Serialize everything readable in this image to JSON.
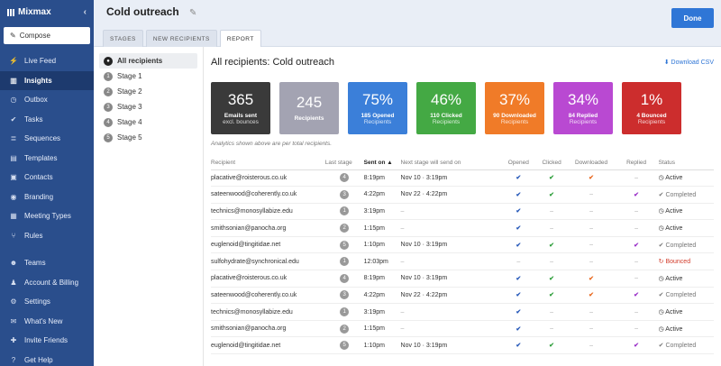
{
  "app": {
    "name": "Mixmax",
    "compose": "Compose"
  },
  "sidebar": {
    "items": [
      {
        "label": "Live Feed",
        "icon": "bolt-icon",
        "glyph": "⚡"
      },
      {
        "label": "Insights",
        "icon": "bar-chart-icon",
        "glyph": "▥",
        "active": true
      },
      {
        "label": "Outbox",
        "icon": "clock-icon",
        "glyph": "◷"
      },
      {
        "label": "Tasks",
        "icon": "check-circle-icon",
        "glyph": "✔"
      },
      {
        "label": "Sequences",
        "icon": "sequences-icon",
        "glyph": "≣"
      },
      {
        "label": "Templates",
        "icon": "document-icon",
        "glyph": "▤"
      },
      {
        "label": "Contacts",
        "icon": "contact-card-icon",
        "glyph": "▣"
      },
      {
        "label": "Branding",
        "icon": "palette-icon",
        "glyph": "◉"
      },
      {
        "label": "Meeting Types",
        "icon": "calendar-icon",
        "glyph": "▦"
      },
      {
        "label": "Rules",
        "icon": "rules-icon",
        "glyph": "⑂"
      }
    ],
    "bottom_items": [
      {
        "label": "Teams",
        "icon": "team-icon",
        "glyph": "☻"
      },
      {
        "label": "Account & Billing",
        "icon": "person-icon",
        "glyph": "♟"
      },
      {
        "label": "Settings",
        "icon": "gear-icon",
        "glyph": "⚙"
      },
      {
        "label": "What's New",
        "icon": "megaphone-icon",
        "glyph": "✉"
      },
      {
        "label": "Invite Friends",
        "icon": "gift-icon",
        "glyph": "✚"
      },
      {
        "label": "Get Help",
        "icon": "help-icon",
        "glyph": "?"
      }
    ]
  },
  "header": {
    "title": "Cold outreach",
    "done": "Done",
    "tabs": [
      "STAGES",
      "NEW RECIPIENTS",
      "REPORT"
    ],
    "active_tab": 2
  },
  "stages": [
    {
      "num": "●",
      "label": "All recipients",
      "active": true
    },
    {
      "num": "1",
      "label": "Stage 1"
    },
    {
      "num": "2",
      "label": "Stage 2"
    },
    {
      "num": "3",
      "label": "Stage 3"
    },
    {
      "num": "4",
      "label": "Stage 4"
    },
    {
      "num": "5",
      "label": "Stage 5"
    }
  ],
  "report": {
    "title": "All recipients: Cold outreach",
    "download": "Download CSV",
    "note": "Analytics shown above are per total recipients.",
    "cards": [
      {
        "big": "365",
        "l1": "Emails sent",
        "l2": "excl. bounces",
        "color": "#3a3a3a"
      },
      {
        "big": "245",
        "l1": "Recipients",
        "l2": "",
        "color": "#a3a3b2"
      },
      {
        "big": "75%",
        "l1": "185 Opened",
        "l2": "Recipients",
        "color": "#3b7fd9"
      },
      {
        "big": "46%",
        "l1": "110 Clicked",
        "l2": "Recipients",
        "color": "#44a944"
      },
      {
        "big": "37%",
        "l1": "90 Downloaded",
        "l2": "Recipients",
        "color": "#f07b28"
      },
      {
        "big": "34%",
        "l1": "84 Replied",
        "l2": "Recipients",
        "color": "#b949d2"
      },
      {
        "big": "1%",
        "l1": "4 Bounced",
        "l2": "Recipients",
        "color": "#cc2d2d"
      }
    ],
    "columns": [
      "Recipient",
      "Last stage",
      "Sent on",
      "Next stage will send on",
      "Opened",
      "Clicked",
      "Downloaded",
      "Replied",
      "Status"
    ],
    "rows": [
      {
        "email": "placative@roisterous.co.uk",
        "stage": "4",
        "sent": "8:19pm",
        "next": "Nov 10 · 3:19pm",
        "opened": "✔",
        "clicked": "✔",
        "downloaded": "✔",
        "replied": "–",
        "status": "Active",
        "status_icon": "◷"
      },
      {
        "email": "sateenwood@coherently.co.uk",
        "stage": "3",
        "sent": "4:22pm",
        "next": "Nov 22 · 4:22pm",
        "opened": "✔",
        "clicked": "✔",
        "downloaded": "–",
        "replied": "✔",
        "status": "Completed",
        "status_icon": "✔"
      },
      {
        "email": "technics@monosyllabize.edu",
        "stage": "1",
        "sent": "3:19pm",
        "next": "–",
        "opened": "✔",
        "clicked": "–",
        "downloaded": "–",
        "replied": "–",
        "status": "Active",
        "status_icon": "◷"
      },
      {
        "email": "smithsonian@panocha.org",
        "stage": "2",
        "sent": "1:15pm",
        "next": "–",
        "opened": "✔",
        "clicked": "–",
        "downloaded": "–",
        "replied": "–",
        "status": "Active",
        "status_icon": "◷"
      },
      {
        "email": "euglenoid@tingitidae.net",
        "stage": "5",
        "sent": "1:10pm",
        "next": "Nov 10 · 3:19pm",
        "opened": "✔",
        "clicked": "✔",
        "downloaded": "–",
        "replied": "✔",
        "status": "Completed",
        "status_icon": "✔"
      },
      {
        "email": "sulfohydrate@synchronical.edu",
        "stage": "1",
        "sent": "12:03pm",
        "next": "–",
        "opened": "–",
        "clicked": "–",
        "downloaded": "–",
        "replied": "–",
        "status": "Bounced",
        "status_icon": "↻"
      },
      {
        "email": "placative@roisterous.co.uk",
        "stage": "4",
        "sent": "8:19pm",
        "next": "Nov 10 · 3:19pm",
        "opened": "✔",
        "clicked": "✔",
        "downloaded": "✔",
        "replied": "–",
        "status": "Active",
        "status_icon": "◷"
      },
      {
        "email": "sateenwood@coherently.co.uk",
        "stage": "3",
        "sent": "4:22pm",
        "next": "Nov 22 · 4:22pm",
        "opened": "✔",
        "clicked": "✔",
        "downloaded": "✔",
        "replied": "✔",
        "status": "Completed",
        "status_icon": "✔"
      },
      {
        "email": "technics@monosyllabize.edu",
        "stage": "1",
        "sent": "3:19pm",
        "next": "–",
        "opened": "✔",
        "clicked": "–",
        "downloaded": "–",
        "replied": "–",
        "status": "Active",
        "status_icon": "◷"
      },
      {
        "email": "smithsonian@panocha.org",
        "stage": "2",
        "sent": "1:15pm",
        "next": "–",
        "opened": "✔",
        "clicked": "–",
        "downloaded": "–",
        "replied": "–",
        "status": "Active",
        "status_icon": "◷"
      },
      {
        "email": "euglenoid@tingitidae.net",
        "stage": "5",
        "sent": "1:10pm",
        "next": "Nov 10 · 3:19pm",
        "opened": "✔",
        "clicked": "✔",
        "downloaded": "–",
        "replied": "✔",
        "status": "Completed",
        "status_icon": "✔"
      }
    ]
  }
}
